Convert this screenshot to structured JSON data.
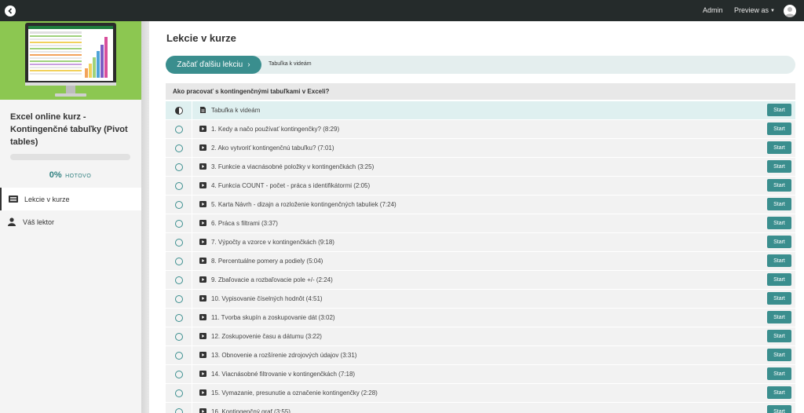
{
  "topbar": {
    "admin_label": "Admin",
    "preview_label": "Preview as"
  },
  "sidebar": {
    "course_title": "Excel online kurz - Kontingenčné tabuľky (Pivot tables)",
    "progress": {
      "percent_value": 0,
      "percent_text": "0%",
      "label": "HOTOVO"
    },
    "nav": [
      {
        "label": "Lekcie v kurze",
        "icon": "list-icon",
        "active": true
      },
      {
        "label": "Váš lektor",
        "icon": "person-icon",
        "active": false
      }
    ]
  },
  "main": {
    "page_title": "Lekcie v kurze",
    "next_lesson": {
      "button_label": "Začať ďalšiu lekciu",
      "button_arrow": "›",
      "lesson_name": "Tabuľka k videám"
    },
    "section_title": "Ako pracovať s kontingenčnými tabuľkami v Exceli?",
    "start_label": "Start",
    "lessons": [
      {
        "title": "Tabuľka k videám",
        "type": "document",
        "status": "in-progress"
      },
      {
        "title": "1. Kedy a načo používať kontingenčky? (8:29)",
        "type": "video",
        "status": "not-started"
      },
      {
        "title": "2. Ako vytvoriť kontingenčnú tabuľku? (7:01)",
        "type": "video",
        "status": "not-started"
      },
      {
        "title": "3. Funkcie a viacnásobné položky v kontingenčkách (3:25)",
        "type": "video",
        "status": "not-started"
      },
      {
        "title": "4. Funkcia COUNT - počet - práca s identifikátormi (2:05)",
        "type": "video",
        "status": "not-started"
      },
      {
        "title": "5. Karta Návrh - dizajn a rozloženie kontingenčných tabuliek (7:24)",
        "type": "video",
        "status": "not-started"
      },
      {
        "title": "6. Práca s filtrami (3:37)",
        "type": "video",
        "status": "not-started"
      },
      {
        "title": "7. Výpočty a vzorce v kontingenčkách (9:18)",
        "type": "video",
        "status": "not-started"
      },
      {
        "title": "8. Percentuálne pomery a podiely (5:04)",
        "type": "video",
        "status": "not-started"
      },
      {
        "title": "9. Zbaľovacie a rozbaľovacie pole +/- (2:24)",
        "type": "video",
        "status": "not-started"
      },
      {
        "title": "10. Vypisovanie číselných hodnôt (4:51)",
        "type": "video",
        "status": "not-started"
      },
      {
        "title": "11. Tvorba skupín a zoskupovanie dát (3:02)",
        "type": "video",
        "status": "not-started"
      },
      {
        "title": "12. Zoskupovenie času a dátumu (3:22)",
        "type": "video",
        "status": "not-started"
      },
      {
        "title": "13. Obnovenie a rozšírenie zdrojových údajov (3:31)",
        "type": "video",
        "status": "not-started"
      },
      {
        "title": "14. Viacnásobné filtrovanie v kontingenčkách (7:18)",
        "type": "video",
        "status": "not-started"
      },
      {
        "title": "15. Vymazanie, presunutie a označenie kontingenčky (2:28)",
        "type": "video",
        "status": "not-started"
      },
      {
        "title": "16. Kontingenčný graf (3:55)",
        "type": "video",
        "status": "not-started"
      }
    ]
  }
}
